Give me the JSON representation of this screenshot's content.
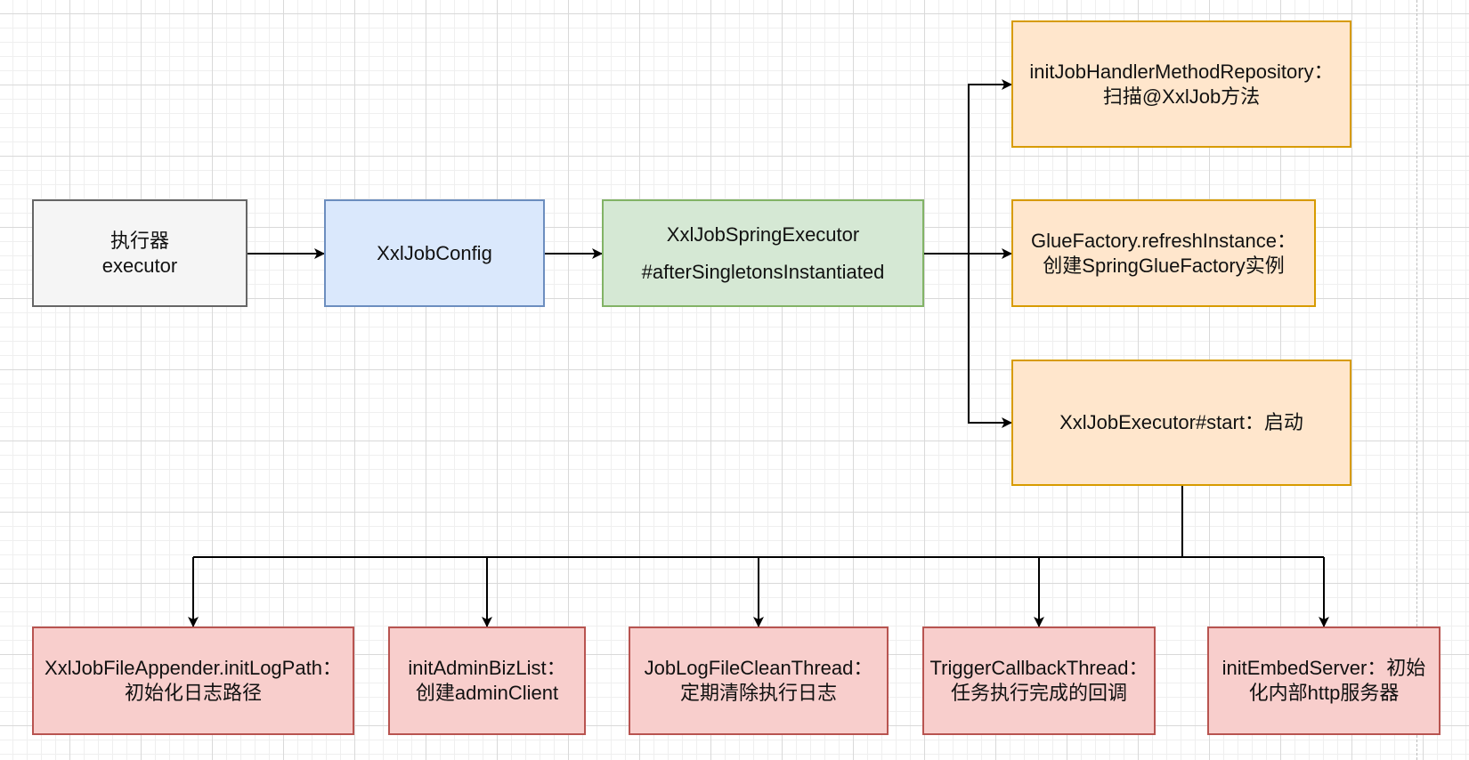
{
  "diagram": {
    "nodes": {
      "executor": {
        "line1": "执行器",
        "line2": "executor"
      },
      "config": {
        "line1": "XxlJobConfig"
      },
      "spring_executor": {
        "line1": "XxlJobSpringExecutor",
        "line2": "#afterSingletonsInstantiated"
      },
      "init_handler_repo": {
        "line1": "initJobHandlerMethodRepository：",
        "line2": "扫描@XxlJob方法"
      },
      "glue_factory": {
        "line1": "GlueFactory.refreshInstance：",
        "line2": "创建SpringGlueFactory实例"
      },
      "executor_start": {
        "line1": "XxlJobExecutor#start：启动"
      },
      "init_log_path": {
        "line1": "XxlJobFileAppender.initLogPath：",
        "line2": "初始化日志路径"
      },
      "init_admin_biz": {
        "line1": "initAdminBizList：",
        "line2": "创建adminClient"
      },
      "log_clean_thread": {
        "line1": "JobLogFileCleanThread：",
        "line2": "定期清除执行日志"
      },
      "callback_thread": {
        "line1": "TriggerCallbackThread：",
        "line2": "任务执行完成的回调"
      },
      "embed_server": {
        "line1": "initEmbedServer：初始",
        "line2": "化内部http服务器"
      }
    },
    "edges": [
      {
        "from": "executor",
        "to": "config"
      },
      {
        "from": "config",
        "to": "spring_executor"
      },
      {
        "from": "spring_executor",
        "to": "init_handler_repo"
      },
      {
        "from": "spring_executor",
        "to": "glue_factory"
      },
      {
        "from": "spring_executor",
        "to": "executor_start"
      },
      {
        "from": "executor_start",
        "to": "init_log_path"
      },
      {
        "from": "executor_start",
        "to": "init_admin_biz"
      },
      {
        "from": "executor_start",
        "to": "log_clean_thread"
      },
      {
        "from": "executor_start",
        "to": "callback_thread"
      },
      {
        "from": "executor_start",
        "to": "embed_server"
      }
    ],
    "colors": {
      "gray_fill": "#f5f5f5",
      "gray_stroke": "#666666",
      "blue_fill": "#dae8fc",
      "blue_stroke": "#6c8ebf",
      "green_fill": "#d5e8d4",
      "green_stroke": "#82b366",
      "orange_fill": "#ffe6cc",
      "orange_stroke": "#d79b00",
      "red_fill": "#f8cecc",
      "red_stroke": "#b85450",
      "connector": "#000000"
    }
  }
}
